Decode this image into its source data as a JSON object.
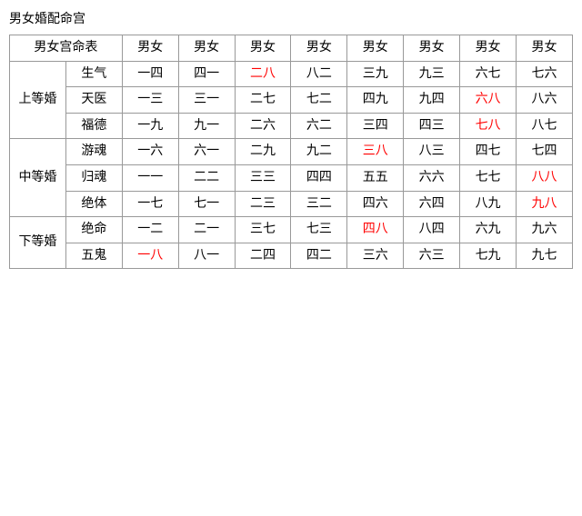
{
  "title": "男女婚配命宫",
  "table": {
    "col_headers": [
      "男女宫命表",
      "男女",
      "男女",
      "男女",
      "男女",
      "男女",
      "男女",
      "男女",
      "男女"
    ],
    "rows": [
      {
        "category": "上等婚",
        "sub_rows": [
          {
            "label": "生气",
            "cells": [
              {
                "text": "一四",
                "red": false
              },
              {
                "text": "四一",
                "red": false
              },
              {
                "text": "二八",
                "red": true
              },
              {
                "text": "八二",
                "red": false
              },
              {
                "text": "三九",
                "red": false
              },
              {
                "text": "九三",
                "red": false
              },
              {
                "text": "六七",
                "red": false
              },
              {
                "text": "七六",
                "red": false
              }
            ]
          },
          {
            "label": "天医",
            "cells": [
              {
                "text": "一三",
                "red": false
              },
              {
                "text": "三一",
                "red": false
              },
              {
                "text": "二七",
                "red": false
              },
              {
                "text": "七二",
                "red": false
              },
              {
                "text": "四九",
                "red": false
              },
              {
                "text": "九四",
                "red": false
              },
              {
                "text": "六八",
                "red": true
              },
              {
                "text": "八六",
                "red": false
              }
            ]
          },
          {
            "label": "福德",
            "cells": [
              {
                "text": "一九",
                "red": false
              },
              {
                "text": "九一",
                "red": false
              },
              {
                "text": "二六",
                "red": false
              },
              {
                "text": "六二",
                "red": false
              },
              {
                "text": "三四",
                "red": false
              },
              {
                "text": "四三",
                "red": false
              },
              {
                "text": "七八",
                "red": true
              },
              {
                "text": "八七",
                "red": false
              }
            ]
          }
        ]
      },
      {
        "category": "中等婚",
        "sub_rows": [
          {
            "label": "游魂",
            "cells": [
              {
                "text": "一六",
                "red": false
              },
              {
                "text": "六一",
                "red": false
              },
              {
                "text": "二九",
                "red": false
              },
              {
                "text": "九二",
                "red": false
              },
              {
                "text": "三八",
                "red": true
              },
              {
                "text": "八三",
                "red": false
              },
              {
                "text": "四七",
                "red": false
              },
              {
                "text": "七四",
                "red": false
              }
            ]
          },
          {
            "label": "归魂",
            "cells": [
              {
                "text": "一一",
                "red": false
              },
              {
                "text": "二二",
                "red": false
              },
              {
                "text": "三三",
                "red": false
              },
              {
                "text": "四四",
                "red": false
              },
              {
                "text": "五五",
                "red": false
              },
              {
                "text": "六六",
                "red": false
              },
              {
                "text": "七七",
                "red": false
              },
              {
                "text": "八八",
                "red": true
              }
            ]
          },
          {
            "label": "绝体",
            "cells": [
              {
                "text": "一七",
                "red": false
              },
              {
                "text": "七一",
                "red": false
              },
              {
                "text": "二三",
                "red": false
              },
              {
                "text": "三二",
                "red": false
              },
              {
                "text": "四六",
                "red": false
              },
              {
                "text": "六四",
                "red": false
              },
              {
                "text": "八九",
                "red": false
              },
              {
                "text": "九八",
                "red": true
              }
            ]
          }
        ]
      },
      {
        "category": "下等婚",
        "sub_rows": [
          {
            "label": "绝命",
            "cells": [
              {
                "text": "一二",
                "red": false
              },
              {
                "text": "二一",
                "red": false
              },
              {
                "text": "三七",
                "red": false
              },
              {
                "text": "七三",
                "red": false
              },
              {
                "text": "四八",
                "red": true
              },
              {
                "text": "八四",
                "red": false
              },
              {
                "text": "六九",
                "red": false
              },
              {
                "text": "九六",
                "red": false
              }
            ]
          },
          {
            "label": "五鬼",
            "cells": [
              {
                "text": "一八",
                "red": true
              },
              {
                "text": "八一",
                "red": false
              },
              {
                "text": "二四",
                "red": false
              },
              {
                "text": "四二",
                "red": false
              },
              {
                "text": "三六",
                "red": false
              },
              {
                "text": "六三",
                "red": false
              },
              {
                "text": "七九",
                "red": false
              },
              {
                "text": "九七",
                "red": false
              }
            ]
          }
        ]
      }
    ]
  }
}
